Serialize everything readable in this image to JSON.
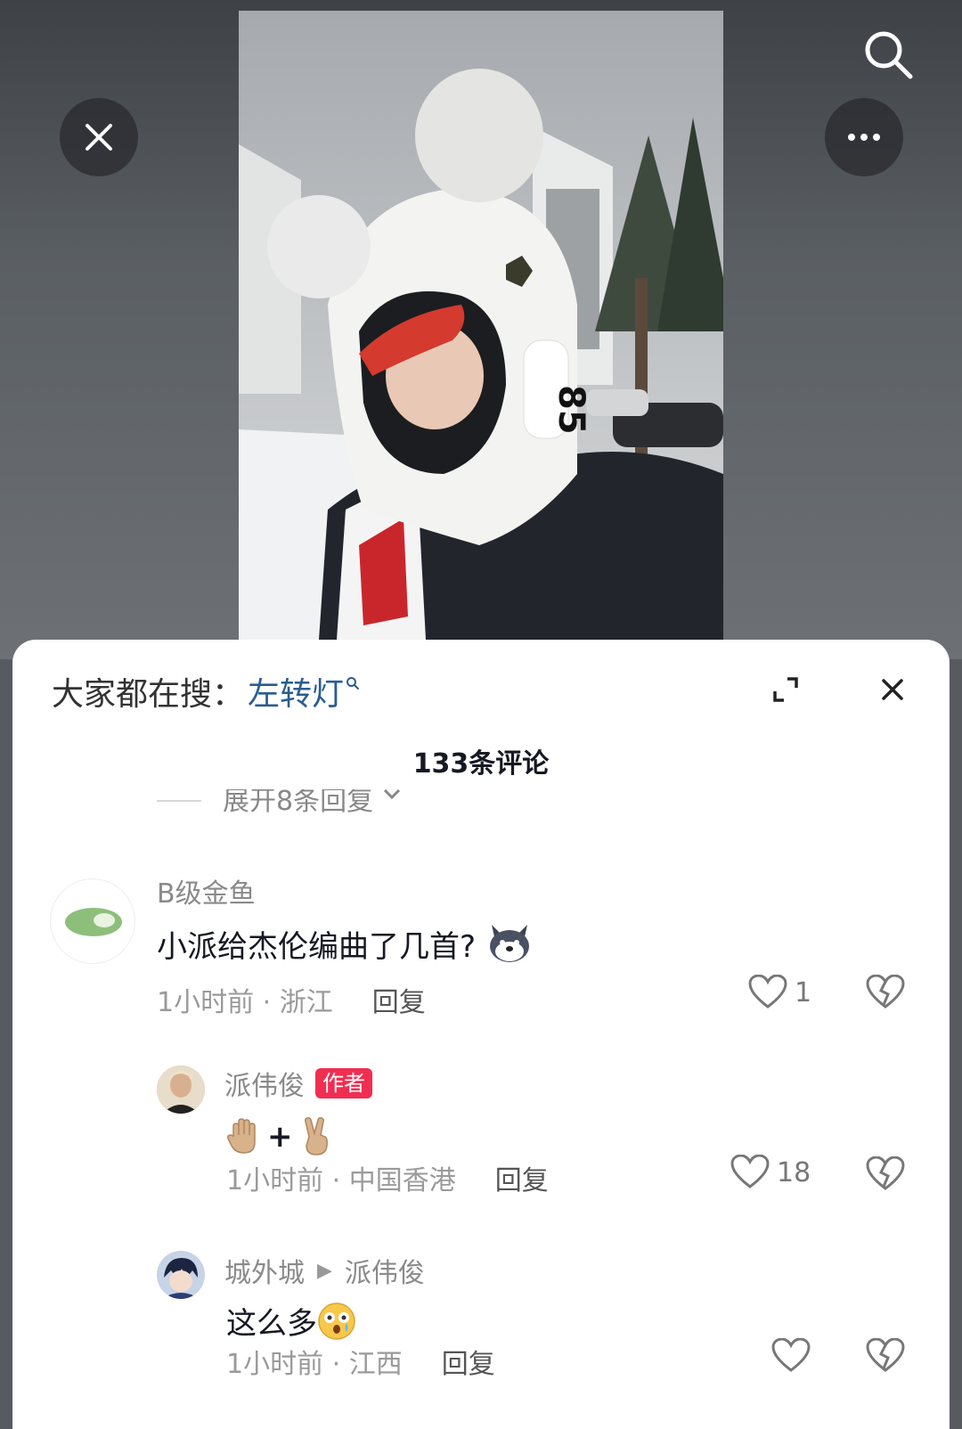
{
  "trending": {
    "prefix": "大家都在搜：",
    "keyword": "左转灯"
  },
  "comments_count": "133条评论",
  "expand_replies": "展开8条回复",
  "comments": [
    {
      "user": "B级金鱼",
      "text": "小派给杰伦编曲了几首?",
      "time_loc": "1小时前 · 浙江",
      "reply": "回复",
      "likes": "1"
    },
    {
      "user": "派伟俊",
      "badge": "作者",
      "text": "+",
      "time_loc": "1小时前 · 中国香港",
      "reply": "回复",
      "likes": "18"
    },
    {
      "user": "城外城",
      "reply_to": "派伟俊",
      "text": "这么多",
      "time_loc": "1小时前 · 江西",
      "reply": "回复",
      "likes": ""
    }
  ],
  "colors": {
    "badge": "#f02e52",
    "keyword": "#2a5d8f",
    "title": "#161823"
  }
}
